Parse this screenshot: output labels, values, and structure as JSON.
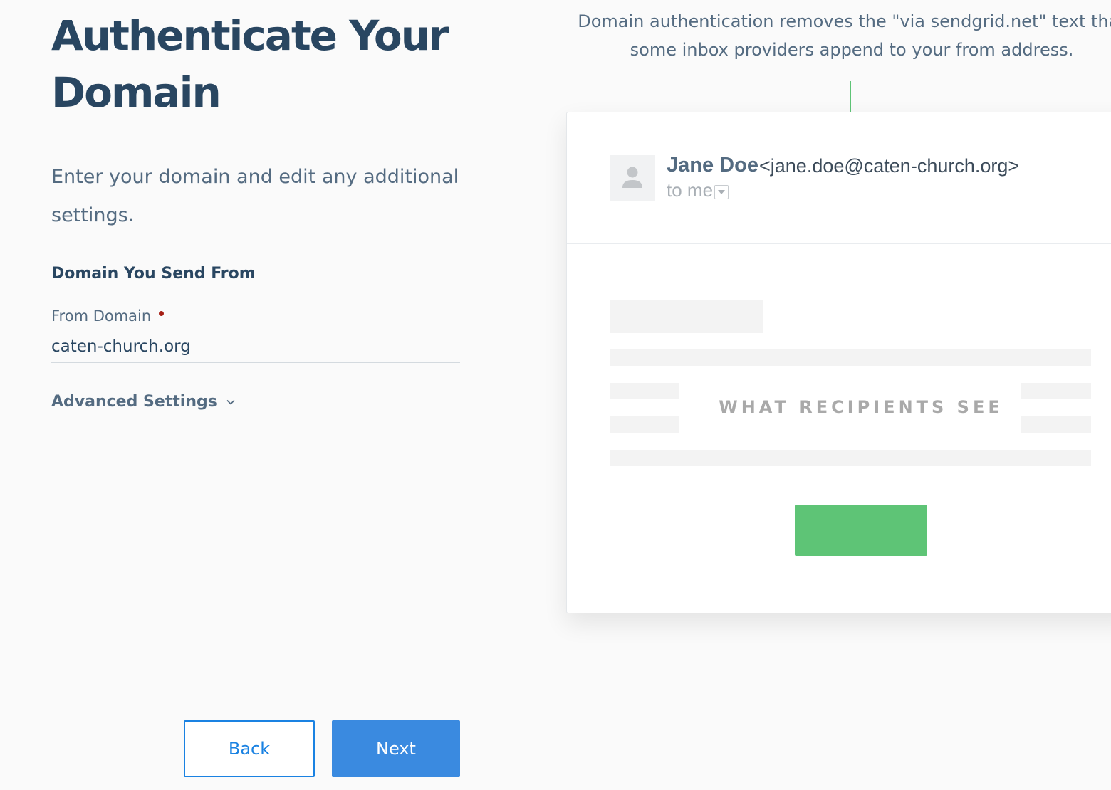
{
  "form": {
    "title": "Authenticate Your Domain",
    "intro": "Enter your domain and edit any additional settings.",
    "section_heading": "Domain You Send From",
    "from_domain_label": "From Domain",
    "from_domain_value": "caten-church.org",
    "advanced_settings_label": "Advanced Settings",
    "back_label": "Back",
    "next_label": "Next"
  },
  "preview": {
    "callout": "Domain authentication removes the \"via sendgrid.net\" text that some inbox providers append to your from address.",
    "sender_name": "Jane Doe",
    "sender_email": "<jane.doe@caten-church.org>",
    "recipient_text": "to me",
    "caption": "WHAT RECIPIENTS SEE"
  },
  "colors": {
    "heading": "#294661",
    "body_text": "#546b81",
    "primary_blue": "#1a82e2",
    "accent_green": "#5ec476",
    "required_red": "#a51e14"
  }
}
